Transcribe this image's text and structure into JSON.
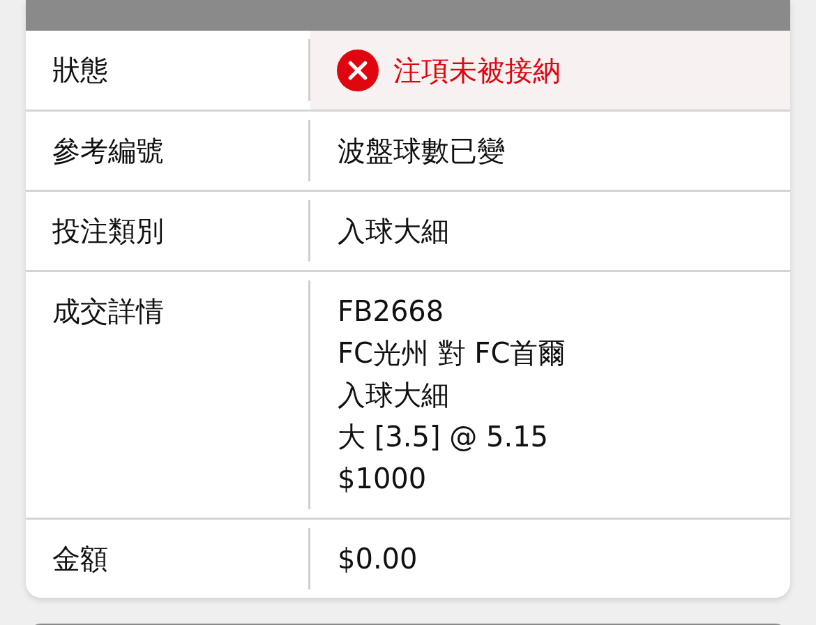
{
  "bet_detail": {
    "rows": [
      {
        "label": "狀態",
        "kind": "status",
        "accepted": false,
        "value": "注項未被接納"
      },
      {
        "label": "參考編號",
        "kind": "text",
        "value": "波盤球數已變"
      },
      {
        "label": "投注類別",
        "kind": "text",
        "value": "入球大細"
      },
      {
        "label": "成交詳情",
        "kind": "lines",
        "lines": [
          "FB2668",
          "FC光州 對 FC首爾",
          "入球大細",
          "大 [3.5] @ 5.15",
          "$1000"
        ]
      },
      {
        "label": "金額",
        "kind": "text",
        "value": "$0.00"
      }
    ]
  }
}
